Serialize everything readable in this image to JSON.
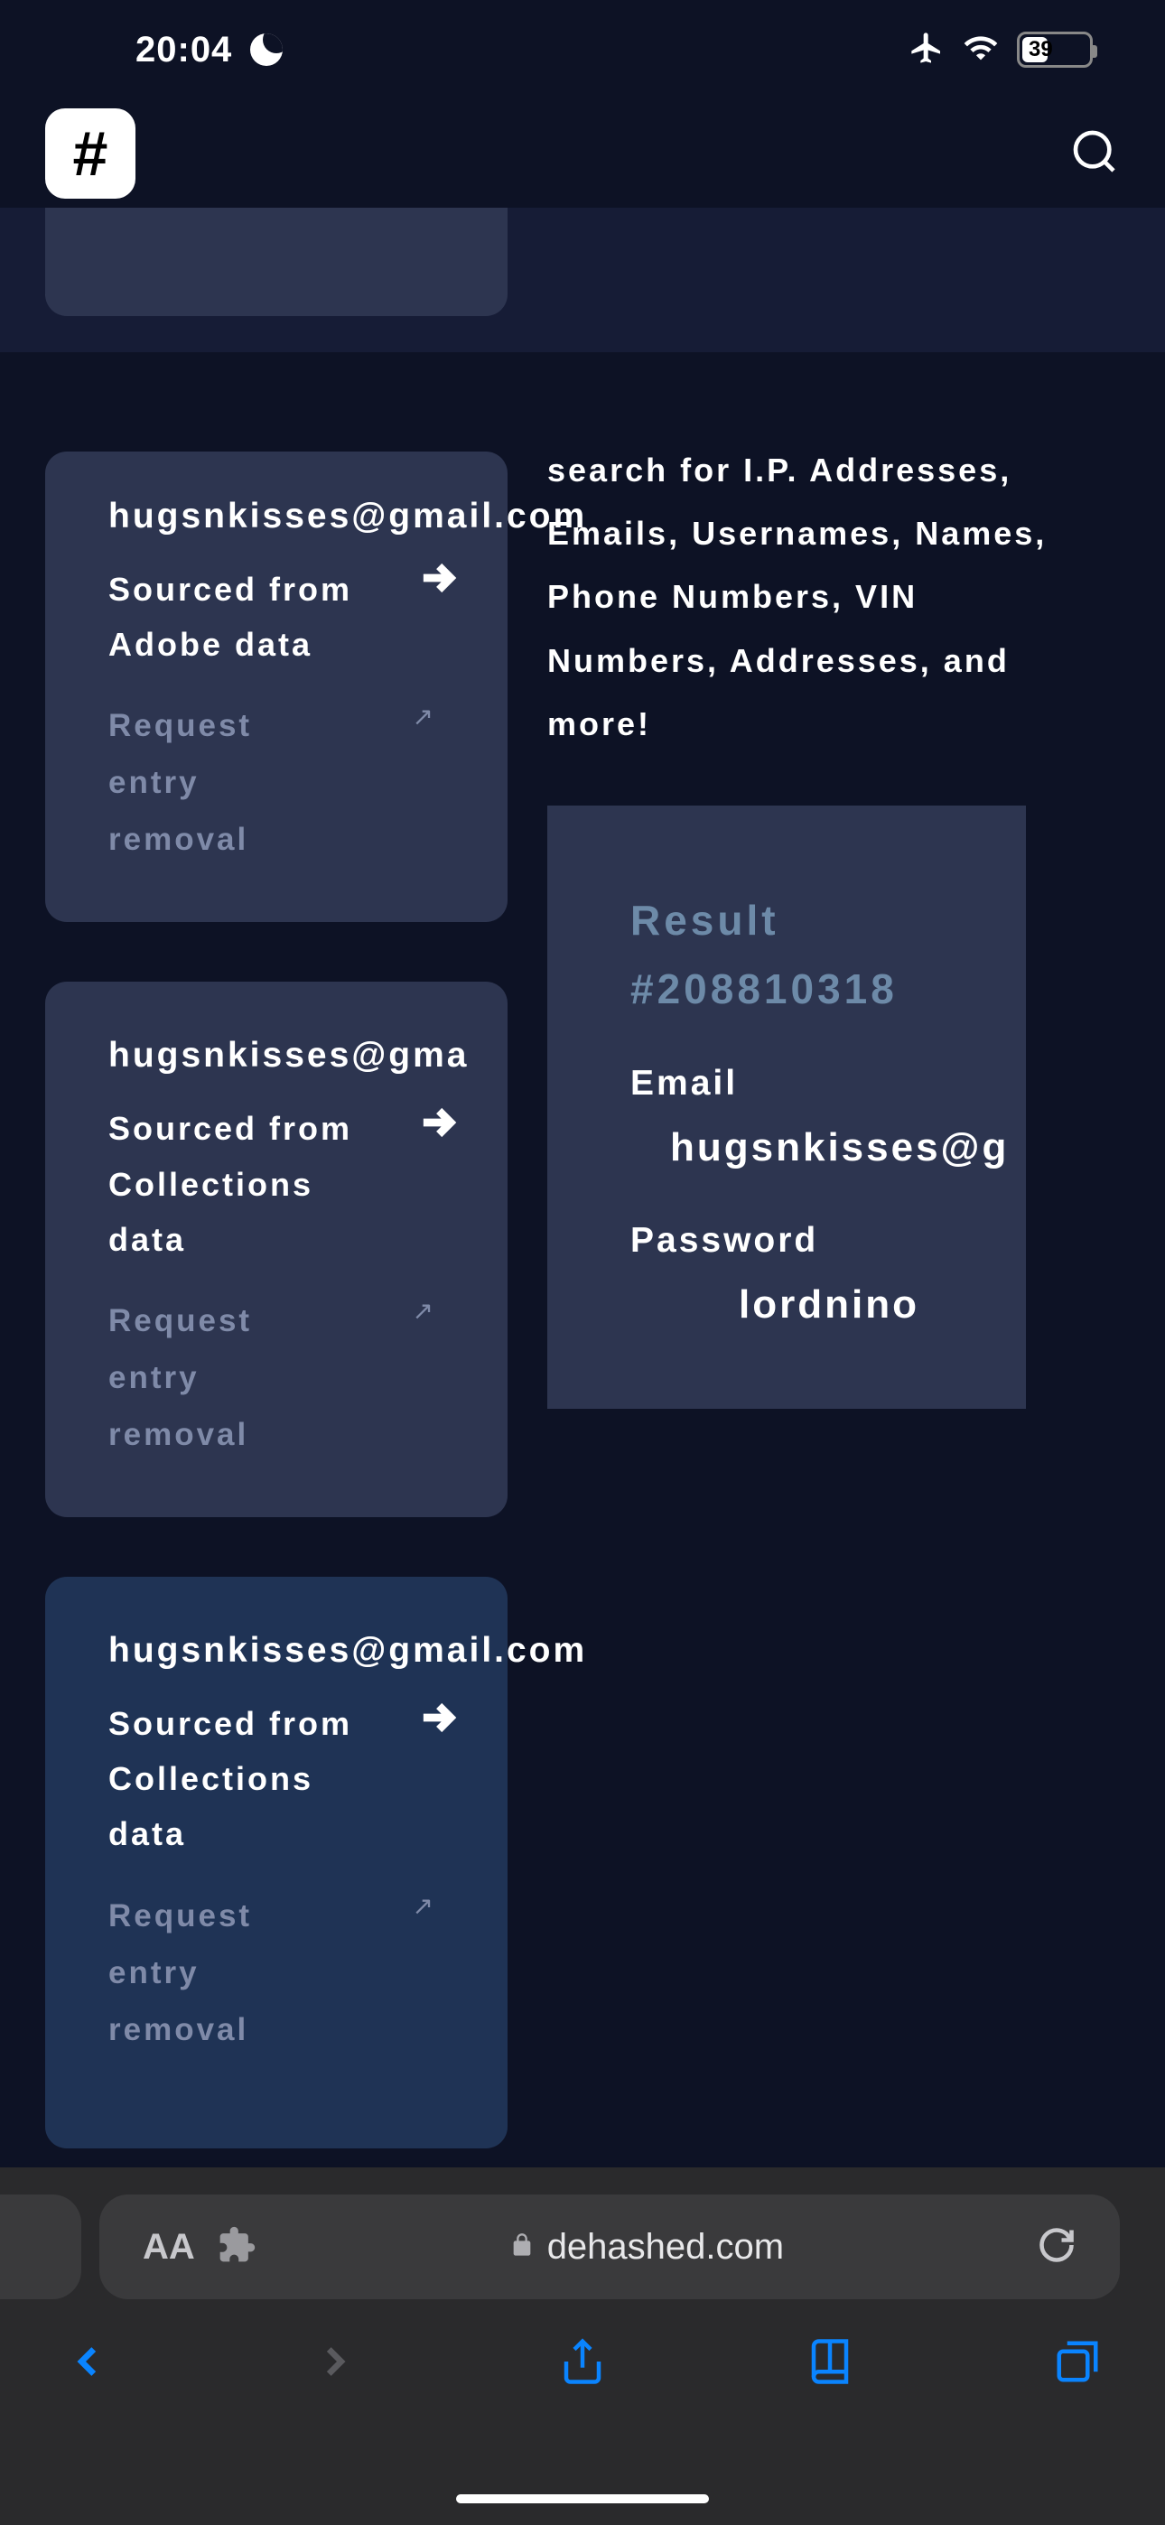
{
  "status": {
    "time": "20:04",
    "battery_pct": "39"
  },
  "right_text": "search for I.P. Addresses, Emails, Usernames, Names, Phone Numbers, VIN Numbers, Addresses, and more!",
  "cards": [
    {
      "email": "hugsnkisses@gmail.com",
      "source": "Sourced from Adobe data",
      "request": "Request entry removal"
    },
    {
      "email": "hugsnkisses@gma",
      "source": "Sourced from Collections data",
      "request": "Request entry removal"
    },
    {
      "email": "hugsnkisses@gmail.com",
      "source": "Sourced from Collections data",
      "request": "Request entry removal"
    }
  ],
  "result": {
    "title": "Result #208810318",
    "email_label": "Email",
    "email_value": "hugsnkisses@g",
    "password_label": "Password",
    "password_value": "lordnino"
  },
  "url": {
    "aa": "AA",
    "domain": "dehashed.com"
  }
}
